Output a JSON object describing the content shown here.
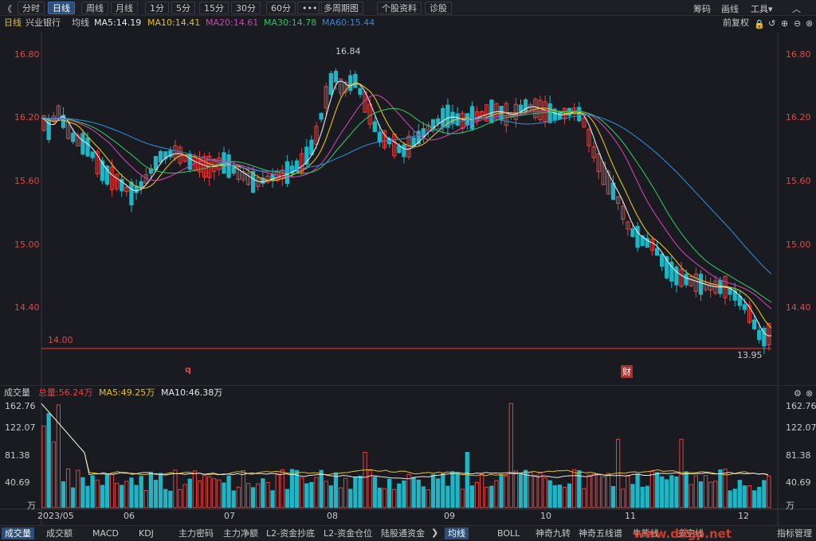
{
  "toolbar": {
    "back": "《",
    "tabs": [
      "分时",
      "日线",
      "周线",
      "月线",
      "1分",
      "5分",
      "15分",
      "30分",
      "60分",
      "•••",
      "多周期图",
      "个股资料",
      "诊股"
    ],
    "active_tab": "日线",
    "right": [
      "筹码",
      "画线",
      "工具▾"
    ]
  },
  "info": {
    "period": "日线",
    "stock": "兴业银行",
    "avg_label": "均线",
    "ma5": "MA5:14.19",
    "ma10": "MA10:14.41",
    "ma20": "MA20:14.61",
    "ma30": "MA30:14.78",
    "ma60": "MA60:15.44",
    "adjust": "前复权",
    "colors": {
      "ma5": "#e8e8e8",
      "ma10": "#e6c020",
      "ma20": "#d040b0",
      "ma30": "#30c060",
      "ma60": "#2f86d6",
      "up": "#e84040",
      "down": "#1fb5c5"
    }
  },
  "axis": {
    "price_ticks": [
      "16.80",
      "16.20",
      "15.60",
      "15.00",
      "14.40"
    ],
    "support_label": "14.00",
    "high_label": "16.84",
    "low_label": "13.95",
    "marker_q": "q",
    "marker_cai": "财",
    "vol_ticks": [
      "162.76",
      "122.07",
      "81.38",
      "40.69"
    ],
    "vol_unit": "万",
    "dates": [
      "2023/05",
      "06",
      "07",
      "08",
      "09",
      "10",
      "11",
      "12"
    ]
  },
  "volume": {
    "label": "成交量",
    "total": "总量:56.24万",
    "ma5": "MA5:49.25万",
    "ma10": "MA10:46.38万"
  },
  "bottom": {
    "left_tabs": [
      "成交量",
      "成交额",
      "MACD",
      "KDJ",
      "主力密码",
      "主力净额",
      "L2-资金抄底",
      "L2-资金仓位",
      "陆股通资金"
    ],
    "right_tabs": [
      "均线",
      "BOLL",
      "神奇九转",
      "神奇五线谱",
      "牛熊线",
      "多空线",
      "指标管理"
    ],
    "watermark": "www.ddgp.net"
  },
  "chart_data": {
    "type": "candlestick",
    "price_ylim": [
      13.95,
      16.84
    ],
    "volume_ylim": [
      0,
      162.76
    ],
    "series": [
      {
        "name": "兴业银行"
      }
    ],
    "ma": {
      "MA5": 14.19,
      "MA10": 14.41,
      "MA20": 14.61,
      "MA30": 14.78,
      "MA60": 15.44
    },
    "support": 14.0,
    "high": 16.84,
    "low": 13.95
  }
}
